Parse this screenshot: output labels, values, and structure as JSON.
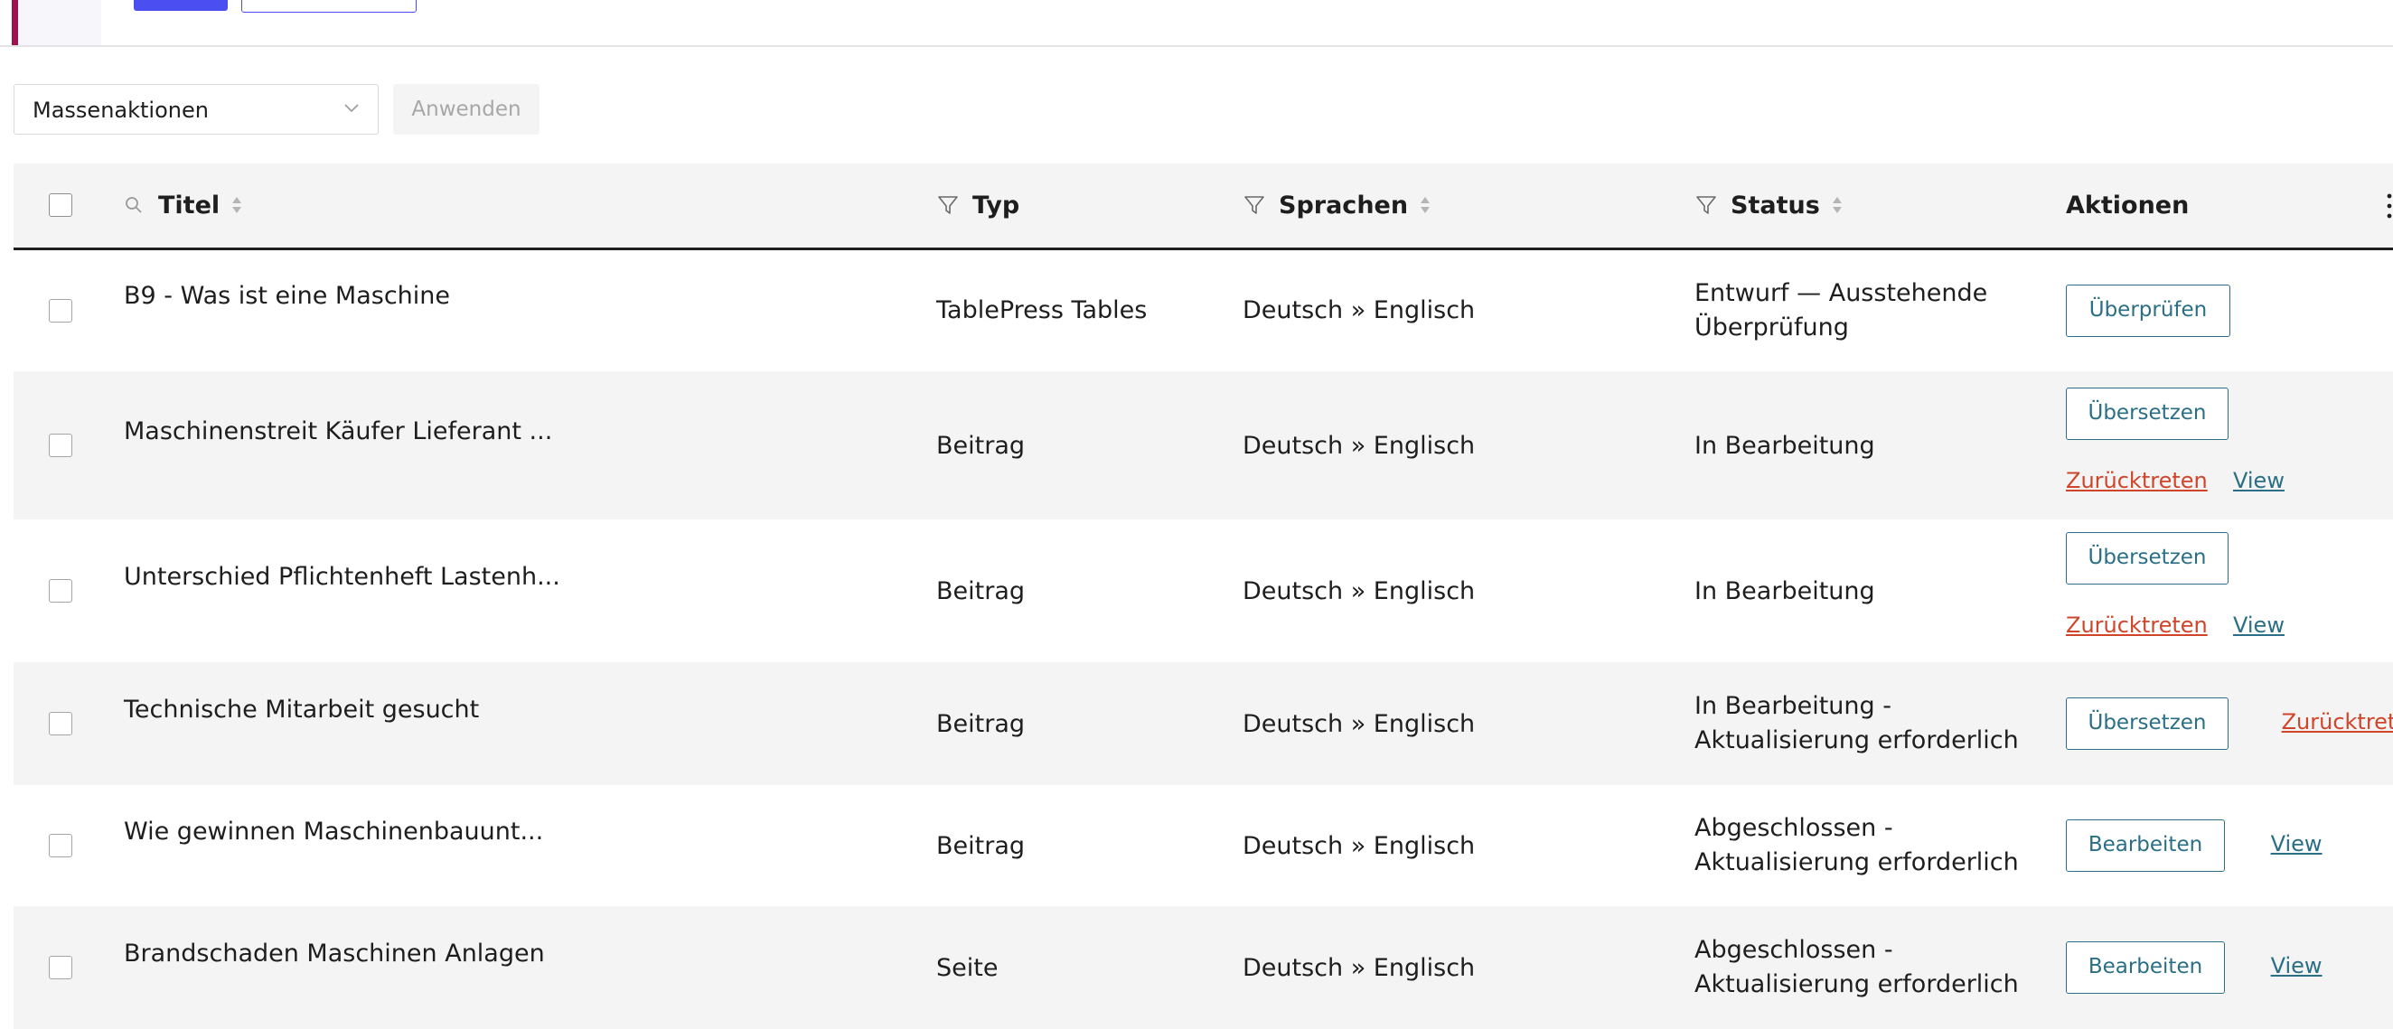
{
  "bulk": {
    "select_value": "Massenaktionen",
    "apply_label": "Anwenden"
  },
  "table": {
    "headers": {
      "title": "Titel",
      "type": "Typ",
      "languages": "Sprachen",
      "status": "Status",
      "actions": "Aktionen"
    },
    "rows": [
      {
        "title": "B9 - Was ist eine Maschine",
        "type": "TablePress Tables",
        "languages": "Deutsch » Englisch",
        "status": "Entwurf — Ausstehende Überprüfung",
        "action_button": "Überprüfen"
      },
      {
        "title": "Maschinenstreit Käufer Lieferant ...",
        "type": "Beitrag",
        "languages": "Deutsch » Englisch",
        "status": "In Bearbeitung",
        "action_button": "Übersetzen",
        "link_withdraw": "Zurücktreten",
        "link_view": "View"
      },
      {
        "title": "Unterschied Pflichtenheft Lastenh...",
        "type": "Beitrag",
        "languages": "Deutsch » Englisch",
        "status": "In Bearbeitung",
        "action_button": "Übersetzen",
        "link_withdraw": "Zurücktreten",
        "link_view": "View"
      },
      {
        "title": "Technische Mitarbeit gesucht",
        "type": "Beitrag",
        "languages": "Deutsch » Englisch",
        "status": "In Bearbeitung - Aktualisierung erforderlich",
        "action_button": "Übersetzen",
        "link_withdraw": "Zurücktreten"
      },
      {
        "title": "Wie gewinnen Maschinenbauunt...",
        "type": "Beitrag",
        "languages": "Deutsch » Englisch",
        "status": "Abgeschlossen - Aktualisierung erforderlich",
        "action_button": "Bearbeiten",
        "link_view": "View"
      },
      {
        "title": "Brandschaden Maschinen Anlagen",
        "type": "Seite",
        "languages": "Deutsch » Englisch",
        "status": "Abgeschlossen - Aktualisierung erforderlich",
        "action_button": "Bearbeiten",
        "link_view": "View"
      }
    ]
  },
  "colors": {
    "brand_accent": "#a0124f",
    "primary": "#4b4ef0",
    "action_teal": "#2a6f86",
    "danger_link": "#d0452a"
  },
  "icons": [
    "chevron-down-icon",
    "search-icon",
    "sort-icon",
    "filter-icon",
    "more-vertical-icon"
  ]
}
